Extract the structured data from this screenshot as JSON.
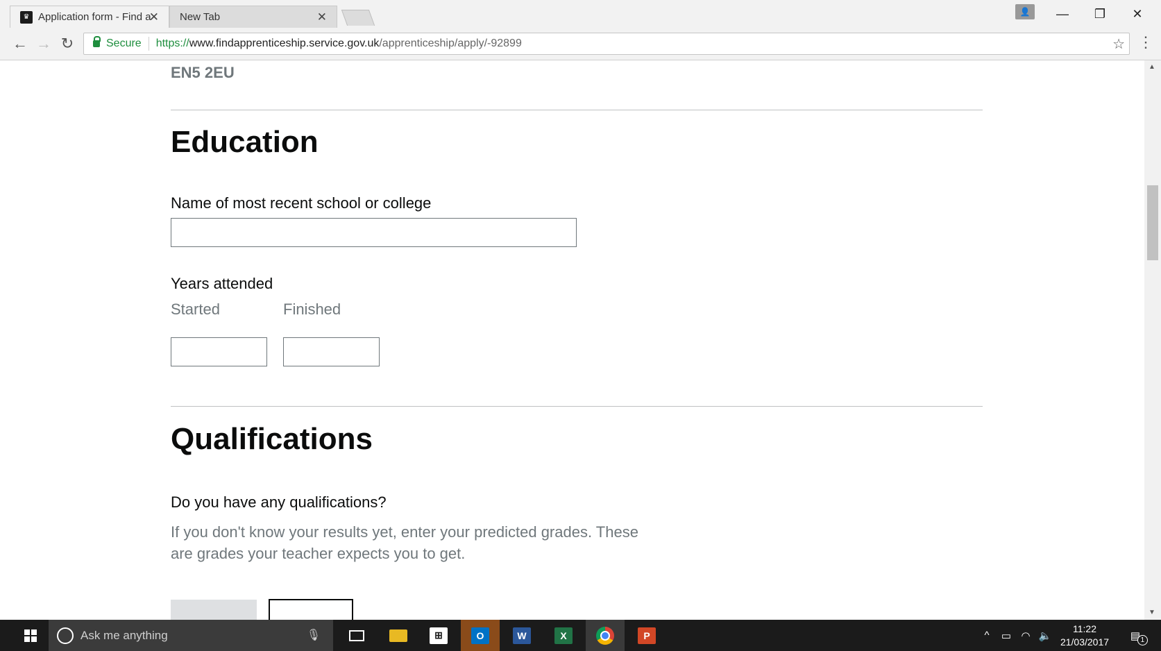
{
  "browser": {
    "tabs": [
      {
        "title": "Application form - Find a",
        "active": true
      },
      {
        "title": "New Tab",
        "active": false
      }
    ],
    "address": {
      "secure_label": "Secure",
      "url_scheme": "https://",
      "url_host": "www.findapprenticeship.service.gov.uk",
      "url_path": "/apprenticeship/apply/-92899"
    }
  },
  "page": {
    "postcode": "EN5 2EU",
    "education": {
      "heading": "Education",
      "school_label": "Name of most recent school or college",
      "school_value": "",
      "years_label": "Years attended",
      "started_label": "Started",
      "finished_label": "Finished",
      "started_value": "",
      "finished_value": ""
    },
    "qualifications": {
      "heading": "Qualifications",
      "question": "Do you have any qualifications?",
      "hint": "If you don't know your results yet, enter your predicted grades. These are grades your teacher expects you to get."
    }
  },
  "taskbar": {
    "search_placeholder": "Ask me anything",
    "time": "11:22",
    "date": "21/03/2017",
    "notification_count": "1"
  },
  "colors": {
    "secure_green": "#1e8e3e",
    "text": "#0b0c0c",
    "secondary_text": "#6f777b",
    "outlook": "#d35400",
    "word": "#2b579a",
    "excel": "#217346",
    "powerpoint": "#d24726"
  }
}
